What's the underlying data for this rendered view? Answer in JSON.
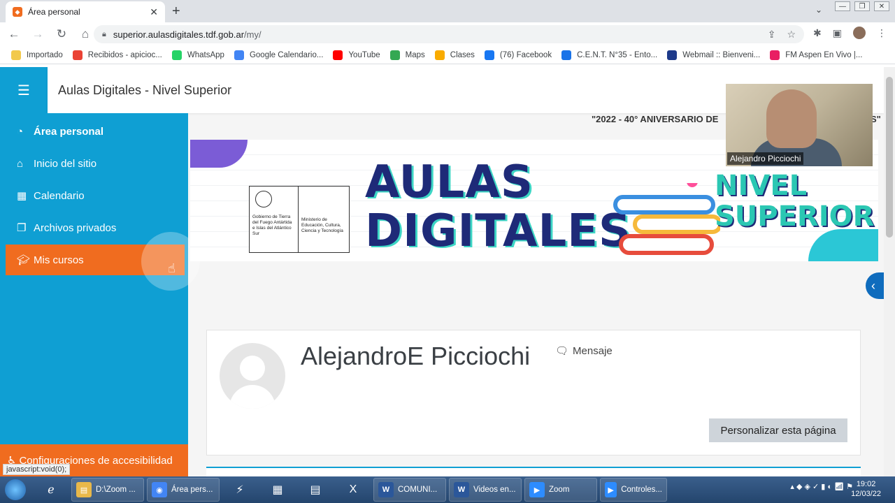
{
  "browser": {
    "tab_title": "Área personal",
    "tab_close": "✕",
    "new_tab": "+",
    "tab_search": "⌄",
    "url_host": "superior.aulasdigitales.tdf.gob.ar",
    "url_path": "/my/",
    "bookmarks": [
      {
        "label": "Importado",
        "color": "#f2c94c"
      },
      {
        "label": "Recibidos - apicioc...",
        "color": "#ea4335"
      },
      {
        "label": "WhatsApp",
        "color": "#25d366"
      },
      {
        "label": "Google Calendario...",
        "color": "#4285f4"
      },
      {
        "label": "YouTube",
        "color": "#ff0000"
      },
      {
        "label": "Maps",
        "color": "#34a853"
      },
      {
        "label": "Clases",
        "color": "#f9ab00"
      },
      {
        "label": "(76) Facebook",
        "color": "#1877f2"
      },
      {
        "label": "C.E.N.T. N°35 - Ento...",
        "color": "#1a73e8"
      },
      {
        "label": "Webmail :: Bienveni...",
        "color": "#1e3a8a"
      },
      {
        "label": "FM Aspen En Vivo |...",
        "color": "#e91e63"
      }
    ]
  },
  "site": {
    "title": "Aulas Digitales - Nivel Superior",
    "menu_icon": "☰",
    "announcement": "\"2022 - 40° ANIVERSARIO DE",
    "announcement_end": "S\""
  },
  "sidebar": {
    "items": [
      {
        "label": "Área personal",
        "icon": "dashboard-icon"
      },
      {
        "label": "Inicio del sitio",
        "icon": "home-icon"
      },
      {
        "label": "Calendario",
        "icon": "calendar-icon"
      },
      {
        "label": "Archivos privados",
        "icon": "files-icon"
      },
      {
        "label": "Mis cursos",
        "icon": "graduation-cap-icon"
      }
    ],
    "accessibility": "Configuraciones de accesibilidad",
    "status_link": "javascript:void(0);"
  },
  "banner": {
    "title_line1": "AULAS",
    "title_line2": "DIGITALES",
    "subtitle_line1": "NIVEL",
    "subtitle_line2": "SUPERIOR",
    "gov_left": "Gobierno de Tierra del Fuego Antártida e Islas del Atlántico Sur",
    "gov_right": "Ministerio de Educación, Cultura, Ciencia y Tecnología"
  },
  "profile": {
    "name": "AlejandroE Picciochi",
    "message": "Mensaje",
    "customize": "Personalizar esta página"
  },
  "video": {
    "caption": "Alejandro Picciochi"
  },
  "taskbar": {
    "apps": [
      {
        "label": "D:\\Zoom ...",
        "color": "#e8b84a",
        "glyph": "▤",
        "width": 104
      },
      {
        "label": "Área pers...",
        "color": "#4285f4",
        "glyph": "◉",
        "width": 104
      },
      {
        "label": "COMUNI...",
        "color": "#2b579a",
        "glyph": "W",
        "width": 104
      },
      {
        "label": "Videos en...",
        "color": "#2b579a",
        "glyph": "W",
        "width": 104
      },
      {
        "label": "Zoom",
        "color": "#2d8cff",
        "glyph": "▶",
        "width": 104
      },
      {
        "label": "Controles...",
        "color": "#2d8cff",
        "glyph": "▶",
        "width": 96
      }
    ],
    "time": "19:02",
    "date": "12/03/22"
  }
}
